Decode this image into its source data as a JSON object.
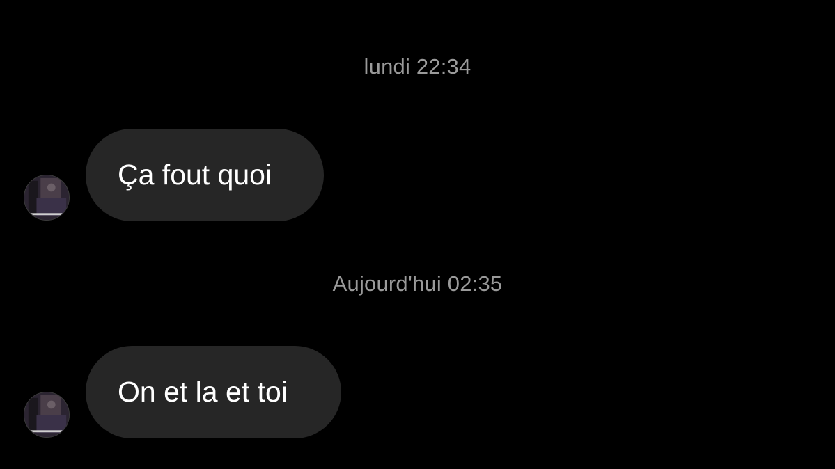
{
  "thread": {
    "messages": [
      {
        "timestamp": "lundi 22:34",
        "text": "Ça fout quoi"
      },
      {
        "timestamp": "Aujourd'hui 02:35",
        "text": "On et la et toi"
      }
    ]
  },
  "colors": {
    "background": "#000000",
    "bubble": "#262626",
    "timestamp": "#9a9a9a",
    "text": "#ffffff"
  },
  "icons": {
    "avatar": "profile-photo-icon"
  }
}
